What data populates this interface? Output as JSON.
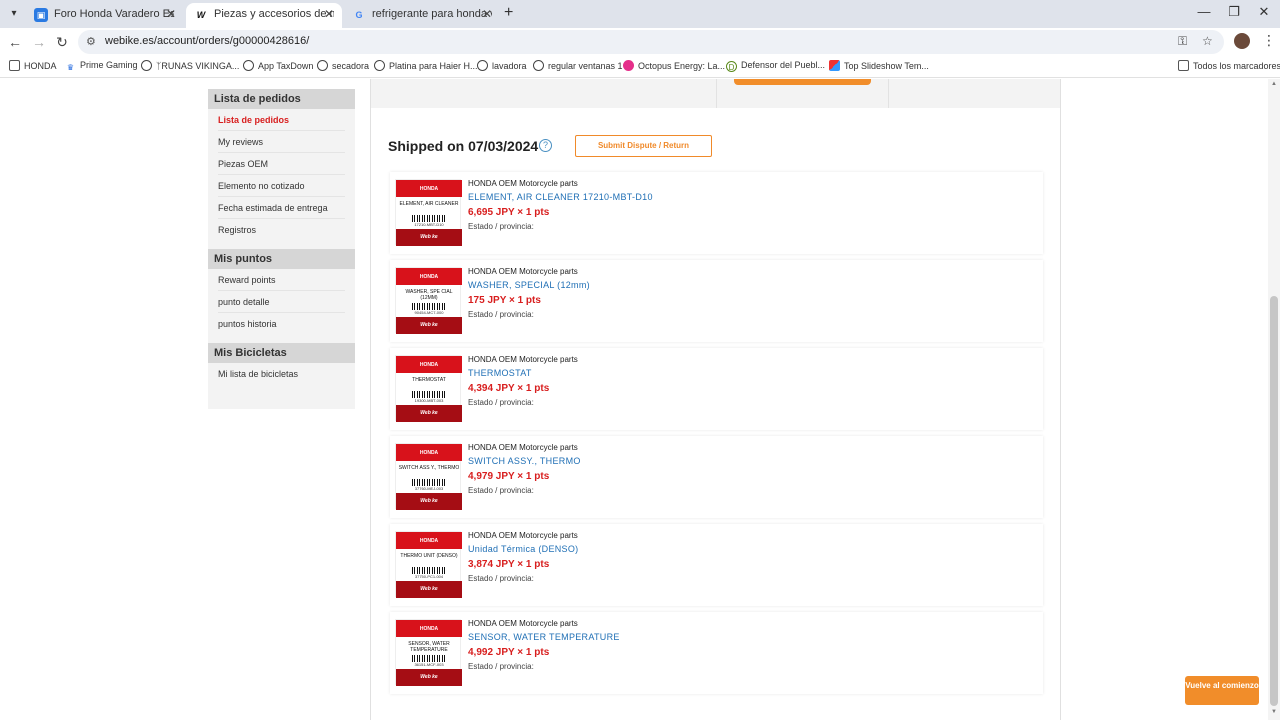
{
  "browser": {
    "tabs": [
      {
        "title": "Foro Honda Varadero España -",
        "favicon": "foro-icon"
      },
      {
        "title": "Piezas y accesorios de motocicl",
        "favicon": "webike-icon"
      },
      {
        "title": "refrigerante para honda varade",
        "favicon": "google-icon"
      }
    ],
    "url": "webike.es/account/orders/g00000428616/",
    "bookmarks": [
      "HONDA",
      "Prime Gaming",
      "ᛉRUNAS VIKINGA...",
      "App TaxDown",
      "secadora",
      "Platina para Haier H...",
      "lavadora",
      "regular ventanas 1",
      "Octopus Energy: La...",
      "Defensor del Puebl...",
      "Top Slideshow Tem..."
    ],
    "all_bookmarks": "Todos los marcadores"
  },
  "sidebar": {
    "sections": [
      {
        "heading": "Lista de pedidos",
        "items": [
          "Lista de pedidos",
          "My reviews",
          "Piezas OEM",
          "Elemento no cotizado",
          "Fecha estimada de entrega",
          "Registros"
        ]
      },
      {
        "heading": "Mis puntos",
        "items": [
          "Reward points",
          "punto detalle",
          "puntos historia"
        ]
      },
      {
        "heading": "Mis Bicicletas",
        "items": [
          "Mi lista de bicicletas"
        ]
      }
    ]
  },
  "order": {
    "shipped_label": "Shipped on 07/03/2024",
    "help_icon": "?",
    "dispute_button": "Submit Dispute / Return",
    "items": [
      {
        "category": "HONDA OEM Motorcycle parts",
        "name": "ELEMENT,   AIR CLEANER 17210-MBT-D10",
        "price": "6,695 JPY × 1 pts",
        "state": "Estado / provincia:",
        "thumb_name": "ELEMENT, AIR CLEANER",
        "thumb_code": "17210-MBT-D10"
      },
      {
        "category": "HONDA OEM Motorcycle parts",
        "name": "WASHER,  SPECIAL (12mm)",
        "price": "175 JPY × 1 pts",
        "state": "Estado / provincia:",
        "thumb_name": "WASHER, SPE CIAL (12MM)",
        "thumb_code": "90454-MC7-000"
      },
      {
        "category": "HONDA OEM Motorcycle parts",
        "name": "THERMOSTAT",
        "price": "4,394 JPY × 1 pts",
        "state": "Estado / provincia:",
        "thumb_name": "THERMOSTAT",
        "thumb_code": "19300-MBT-003"
      },
      {
        "category": "HONDA OEM Motorcycle parts",
        "name": "SWITCH ASSY.,  THERMO",
        "price": "4,979 JPY × 1 pts",
        "state": "Estado / provincia:",
        "thumb_name": "SWITCH ASS Y., THERMO",
        "thumb_code": "37760-MEJ-003"
      },
      {
        "category": "HONDA OEM Motorcycle parts",
        "name": "Unidad Térmica (DENSO)",
        "price": "3,874 JPY × 1 pts",
        "state": "Estado / provincia:",
        "thumb_name": "THERMO UNIT (DENSO)",
        "thumb_code": "37750-PC1-004"
      },
      {
        "category": "HONDA OEM Motorcycle parts",
        "name": "SENSOR,  WATER TEMPERATURE",
        "price": "4,992 JPY × 1 pts",
        "state": "Estado / provincia:",
        "thumb_name": "SENSOR, WATER TEMPERATURE",
        "thumb_code": "36151-MCF-003"
      }
    ],
    "thumb_brand": "HONDA",
    "thumb_logo": "Web ke"
  },
  "back_to_top": "Vuelve al comienzo",
  "colors": {
    "accent_orange": "#f18d2a",
    "price_red": "#d81e1e",
    "link_blue": "#1f6fb5",
    "honda_red": "#d8121b"
  }
}
